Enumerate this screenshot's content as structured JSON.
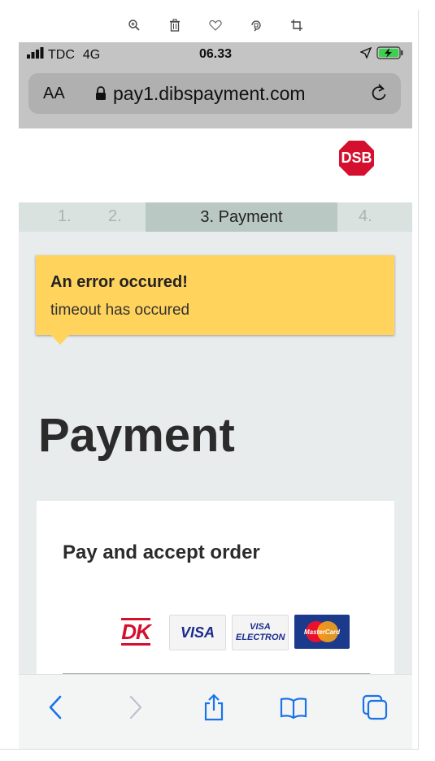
{
  "viewer_toolbar": {
    "icons": [
      "zoom-in-icon",
      "trash-icon",
      "heart-icon",
      "rotate-icon",
      "crop-icon"
    ]
  },
  "status_bar": {
    "carrier": "TDC",
    "network": "4G",
    "time": "06.33",
    "battery_status": "charging"
  },
  "address_bar": {
    "text_size_label": "AA",
    "url": "pay1.dibspayment.com"
  },
  "site_header": {
    "logo_text": "DSB"
  },
  "steps": [
    {
      "label": "1."
    },
    {
      "label": "2."
    },
    {
      "label": "3. Payment",
      "active": true
    },
    {
      "label": "4."
    }
  ],
  "error": {
    "title": "An error occured!",
    "message": "timeout has occured"
  },
  "page": {
    "title": "Payment"
  },
  "card": {
    "title": "Pay and accept order",
    "payment_logos": [
      "DK",
      "VISA",
      "VISA ELECTRON",
      "MasterCard"
    ]
  },
  "colors": {
    "accent": "#d50f2e",
    "ios_blue": "#1a73e8",
    "error_bg": "#ffd35c"
  }
}
